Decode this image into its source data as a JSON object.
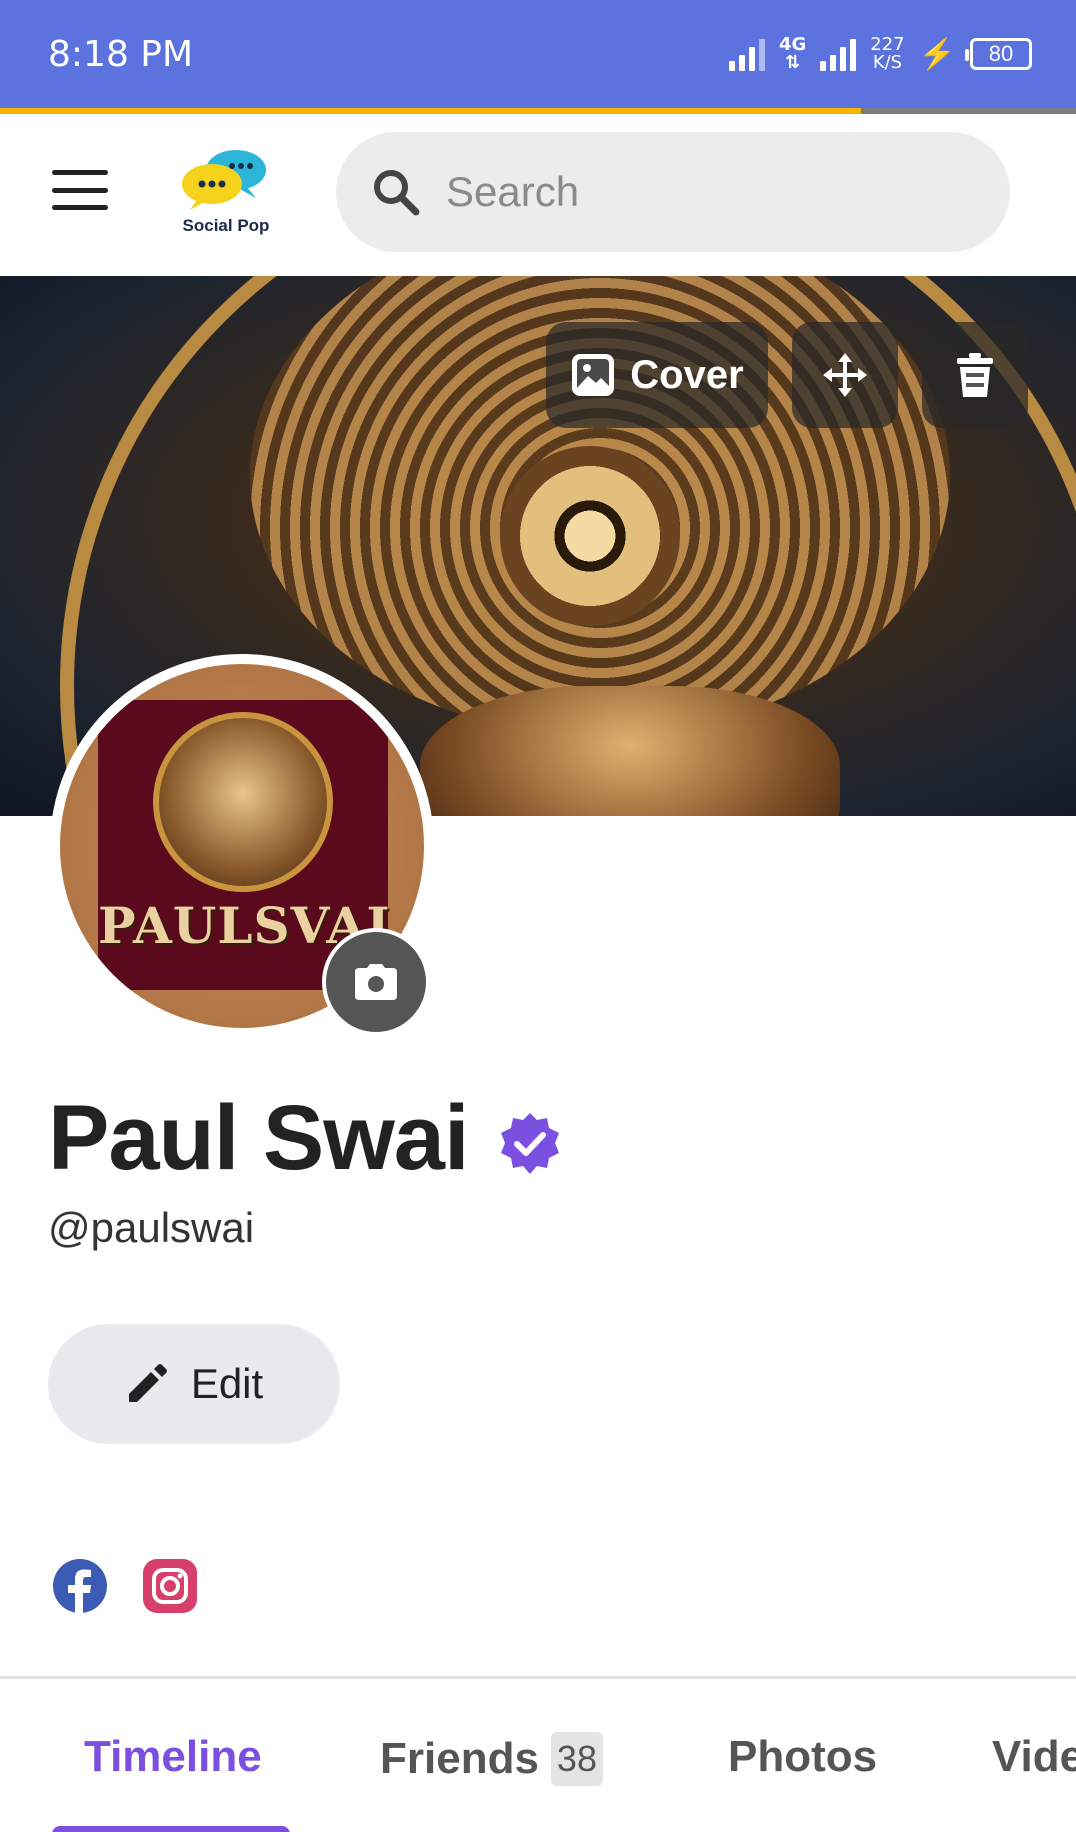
{
  "status_bar": {
    "time": "8:18 PM",
    "network": "4G",
    "speed_value": "227",
    "speed_unit": "K/S",
    "battery": "80",
    "page_load_progress": 0.8
  },
  "header": {
    "logo_text": "Social Pop",
    "search_placeholder": "Search"
  },
  "cover": {
    "cover_button_label": "Cover"
  },
  "profile": {
    "name": "Paul Swai",
    "handle": "@paulswai",
    "avatar_text": "PAULSVAI",
    "edit_label": "Edit"
  },
  "social_links": [
    "facebook-icon",
    "instagram-icon"
  ],
  "tabs": [
    {
      "label": "Timeline",
      "active": true
    },
    {
      "label": "Friends",
      "count": "38"
    },
    {
      "label": "Photos"
    },
    {
      "label": "Vide"
    }
  ],
  "colors": {
    "status_bar": "#5c72df",
    "accent": "#7b4fe0",
    "progress": "#f5b400",
    "facebook": "#3b5bb5",
    "instagram": "#d6406a"
  }
}
